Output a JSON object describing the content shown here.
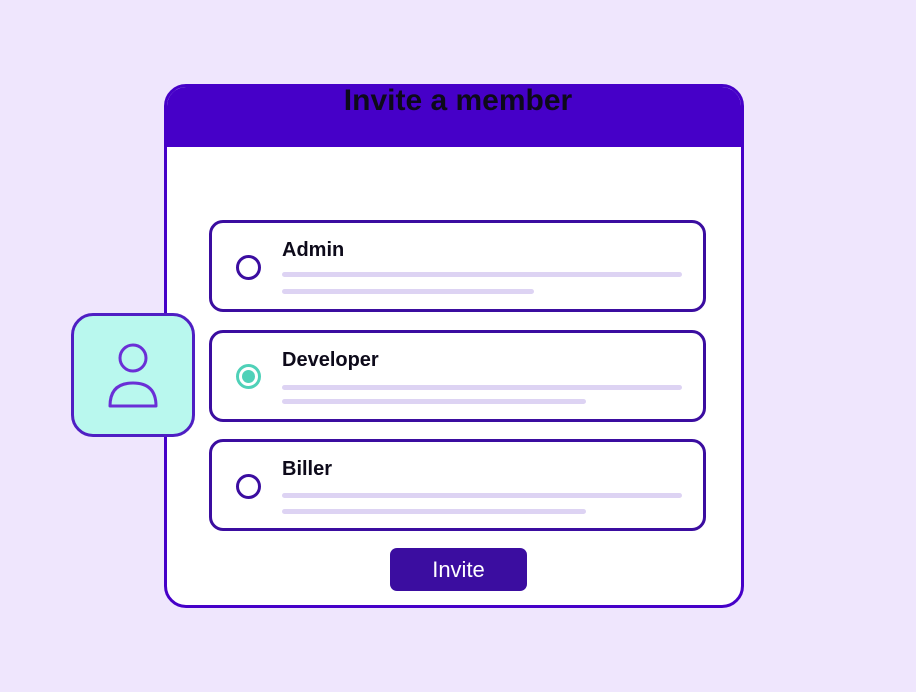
{
  "dialog": {
    "title": "Invite a member",
    "titlebar_color": "#4600C8",
    "options": [
      {
        "label": "Admin",
        "selected": false
      },
      {
        "label": "Developer",
        "selected": true
      },
      {
        "label": "Biller",
        "selected": false
      }
    ],
    "invite_label": "Invite"
  },
  "avatar": {
    "icon": "user-icon"
  },
  "colors": {
    "background": "#EFE6FD",
    "accent": "#4600C8",
    "selected": "#4FD1B8",
    "avatar_bg": "#B9F8EE"
  }
}
